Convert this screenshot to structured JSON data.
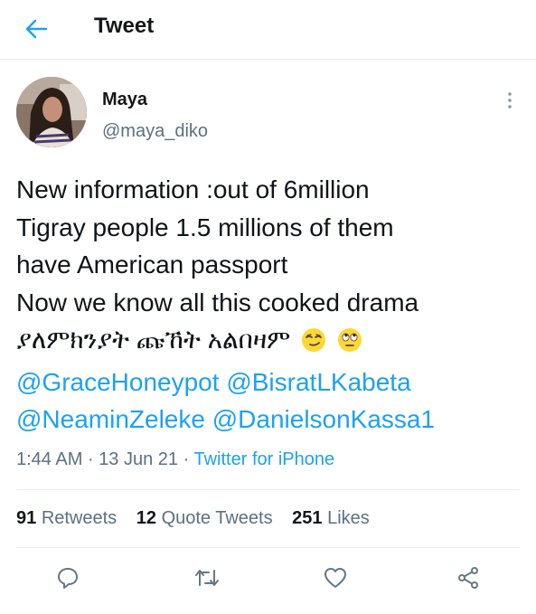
{
  "header": {
    "title": "Tweet",
    "back_icon": "arrow-left-icon",
    "accent": "#1da1f2"
  },
  "author": {
    "display_name": "Maya",
    "handle": "@maya_diko",
    "more_icon": "more-vertical-icon"
  },
  "tweet": {
    "lines": [
      "New information :out of 6million",
      "Tigray people 1.5 millions of them",
      "have American passport",
      "Now we know all this cooked drama"
    ],
    "amharic_line": "ያለምክንያት ጩኸት አልበዛም",
    "emojis": [
      "smirking-face-icon",
      "face-with-rolling-eyes-icon"
    ],
    "mentions_line1": [
      "@GraceHoneypot",
      "@BisratLKabeta"
    ],
    "mentions_line2": [
      "@NeaminZeleke",
      "@DanielsonKassa1"
    ]
  },
  "meta": {
    "time": "1:44 AM",
    "separator": "·",
    "date": "13 Jun 21",
    "source": "Twitter for iPhone"
  },
  "stats": {
    "retweets_count": "91",
    "retweets_label": "Retweets",
    "quotes_count": "12",
    "quotes_label": "Quote Tweets",
    "likes_count": "251",
    "likes_label": "Likes"
  },
  "actions": {
    "reply_icon": "reply-icon",
    "retweet_icon": "retweet-icon",
    "like_icon": "heart-icon",
    "share_icon": "share-icon"
  },
  "colors": {
    "text": "#0f1419",
    "secondary": "#5b7083",
    "link": "#1da1f2",
    "divider": "#e6ecf0"
  }
}
